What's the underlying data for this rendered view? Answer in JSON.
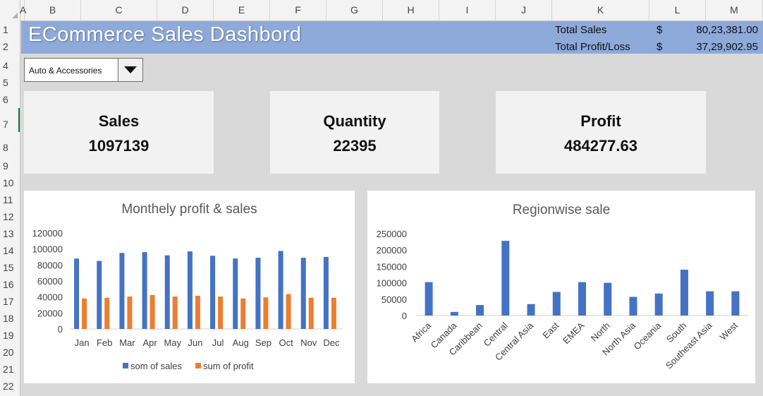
{
  "columns": [
    "A",
    "B",
    "C",
    "D",
    "E",
    "F",
    "G",
    "H",
    "I",
    "J",
    "K",
    "L",
    "M"
  ],
  "rows": [
    "1",
    "2",
    "4",
    "5",
    "6",
    "7",
    "8",
    "9",
    "10",
    "11",
    "12",
    "13",
    "14",
    "15",
    "16",
    "17",
    "18",
    "19",
    "20",
    "21",
    "22"
  ],
  "header": {
    "title": "ECommerce Sales Dashbord",
    "total_sales_label": "Total Sales",
    "total_sales_currency": "$",
    "total_sales_value": "80,23,381.00",
    "total_profit_label": "Total Profit/Loss",
    "total_profit_currency": "$",
    "total_profit_value": "37,29,902.95"
  },
  "filter": {
    "selected": "Auto & Accessories"
  },
  "cards": {
    "sales": {
      "title": "Sales",
      "value": "1097139"
    },
    "quantity": {
      "title": "Quantity",
      "value": "22395"
    },
    "profit": {
      "title": "Profit",
      "value": "484277.63"
    }
  },
  "colors": {
    "banner": "#8eaadb",
    "series_blue": "#4472c4",
    "series_orange": "#ed7d31"
  },
  "chart_data": [
    {
      "type": "bar",
      "title": "Monthely profit & sales",
      "categories": [
        "Jan",
        "Feb",
        "Mar",
        "Apr",
        "May",
        "Jun",
        "Jul",
        "Aug",
        "Sep",
        "Oct",
        "Nov",
        "Dec"
      ],
      "series": [
        {
          "name": "som of sales",
          "color": "#4472c4",
          "values": [
            88000,
            85000,
            95000,
            96000,
            92000,
            97000,
            91500,
            88000,
            89000,
            97500,
            89000,
            90000
          ]
        },
        {
          "name": "sum of profit",
          "color": "#ed7d31",
          "values": [
            38000,
            39000,
            40500,
            42500,
            40500,
            41500,
            40500,
            38000,
            39500,
            43500,
            39000,
            39000
          ]
        }
      ],
      "yticks": [
        "0",
        "20000",
        "40000",
        "60000",
        "80000",
        "100000",
        "120000"
      ],
      "ylim": [
        0,
        120000
      ],
      "legend": "bottom"
    },
    {
      "type": "bar",
      "title": "Regionwise sale",
      "categories": [
        "Africa",
        "Canada",
        "Caribbean",
        "Central",
        "Central Asia",
        "East",
        "EMEA",
        "North",
        "North Asia",
        "Oceania",
        "South",
        "Southeast Asia",
        "West"
      ],
      "series": [
        {
          "color": "#4472c4",
          "values": [
            102000,
            11000,
            32000,
            228000,
            35000,
            72000,
            102000,
            100000,
            57000,
            67000,
            140000,
            74000,
            74000
          ]
        }
      ],
      "yticks": [
        "0",
        "50000",
        "100000",
        "150000",
        "200000",
        "250000"
      ],
      "ylim": [
        0,
        250000
      ]
    }
  ]
}
